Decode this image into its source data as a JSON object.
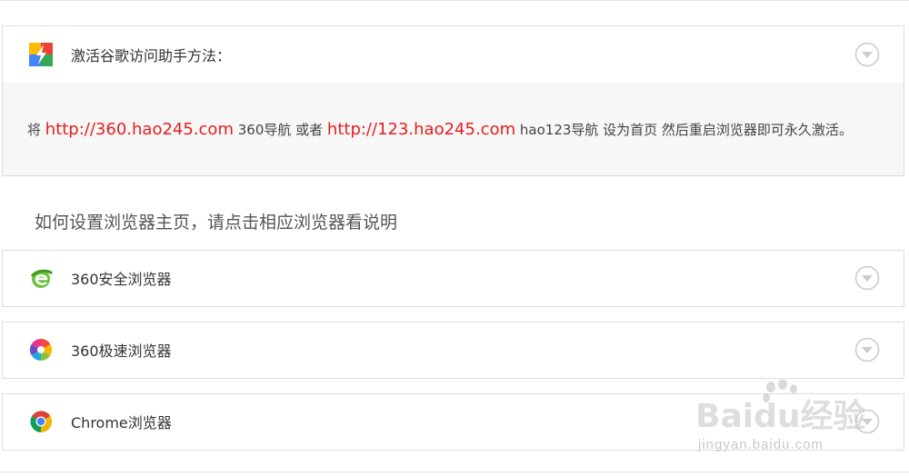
{
  "activation_panel": {
    "title": "激活谷歌访问助手方法：",
    "body": {
      "prefix": "将 ",
      "link1": "http://360.hao245.com",
      "mid1": " 360导航 或者 ",
      "link2": "http://123.hao245.com",
      "suffix": " hao123导航 设为首页 然后重启浏览器即可永久激活。"
    }
  },
  "section_title": "如何设置浏览器主页，请点击相应浏览器看说明",
  "browsers": [
    {
      "label": "360安全浏览器",
      "icon": "360-safe-browser-icon"
    },
    {
      "label": "360极速浏览器",
      "icon": "360-speed-browser-icon"
    },
    {
      "label": "Chrome浏览器",
      "icon": "chrome-icon"
    }
  ],
  "watermark": {
    "brand": "Baidu经验",
    "url": "jingyan.baidu.com"
  },
  "colors": {
    "link": "#e61e1e",
    "panel_border": "#dcdcdc",
    "panel_body_bg": "#f7f7f7",
    "chevron": "#cccccc"
  }
}
